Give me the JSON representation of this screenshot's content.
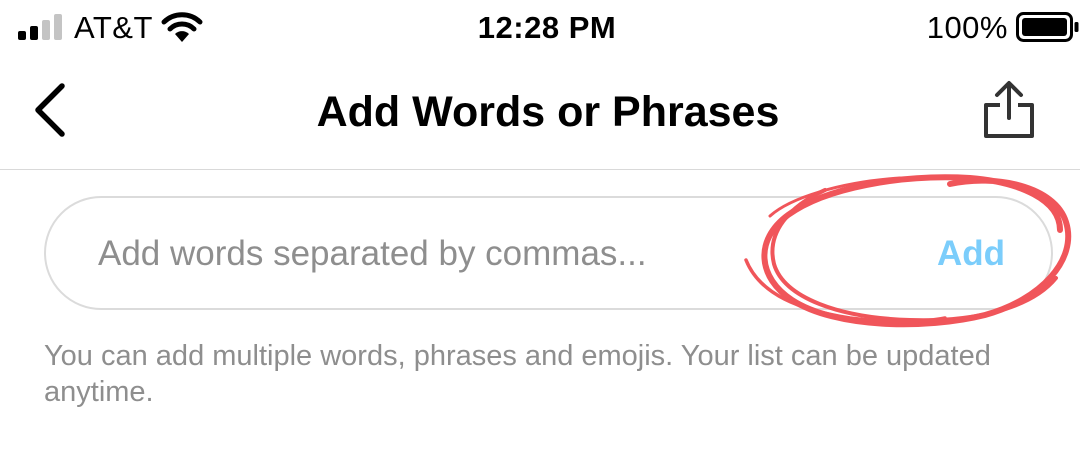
{
  "status_bar": {
    "carrier": "AT&T",
    "time": "12:28 PM",
    "battery_percent": "100%",
    "signal_icon": "cellular-signal-icon",
    "wifi_icon": "wifi-icon",
    "battery_icon": "battery-full-icon"
  },
  "nav": {
    "title": "Add Words or Phrases",
    "back_icon": "chevron-left-icon",
    "share_icon": "share-icon"
  },
  "input": {
    "placeholder": "Add words separated by commas...",
    "value": "",
    "add_label": "Add"
  },
  "helper_text": "You can add multiple words, phrases and emojis. Your list can be updated anytime.",
  "colors": {
    "add_button": "#7bcdfb",
    "annotation_circle": "#f0555a",
    "placeholder": "#8e8e8e",
    "divider": "#d9d9d9"
  }
}
